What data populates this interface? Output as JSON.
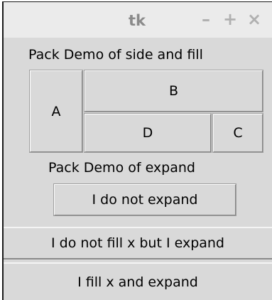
{
  "window": {
    "title": "tk",
    "controls": {
      "minimize": "–",
      "maximize": "+",
      "close": "×"
    }
  },
  "demo1": {
    "label": "Pack Demo of side and fill",
    "buttons": {
      "a": "A",
      "b": "B",
      "d": "D",
      "c": "C"
    }
  },
  "demo2": {
    "label": "Pack Demo of expand",
    "buttons": {
      "no_expand": "I do not expand",
      "no_fill_expand": "I do not fill x but I expand",
      "fill_expand": "I fill x and expand"
    }
  }
}
